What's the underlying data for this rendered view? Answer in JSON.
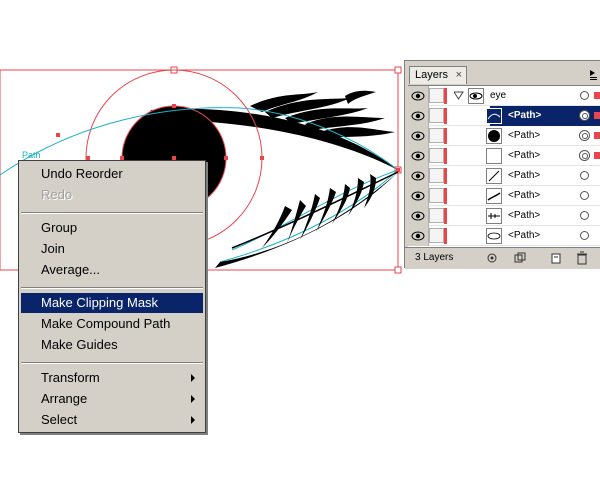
{
  "canvas": {
    "path_label": "Path",
    "colors": {
      "guide": "#e8454d",
      "path": "#1ab3c7",
      "art": "#000000"
    }
  },
  "context_menu": {
    "items": [
      {
        "label": "Undo Reorder",
        "enabled": true
      },
      {
        "label": "Redo",
        "enabled": false
      },
      {
        "label": "Group",
        "enabled": true
      },
      {
        "label": "Join",
        "enabled": true
      },
      {
        "label": "Average...",
        "enabled": true
      },
      {
        "label": "Make Clipping Mask",
        "enabled": true,
        "highlighted": true
      },
      {
        "label": "Make Compound Path",
        "enabled": true
      },
      {
        "label": "Make Guides",
        "enabled": true
      },
      {
        "label": "Transform",
        "enabled": true,
        "submenu": true
      },
      {
        "label": "Arrange",
        "enabled": true,
        "submenu": true
      },
      {
        "label": "Select",
        "enabled": true,
        "submenu": true
      }
    ],
    "highlight_color": "#0a246a"
  },
  "layers_panel": {
    "tab_label": "Layers",
    "close_glyph": "×",
    "layer_name": "eye",
    "rows": [
      {
        "label": "<Path>",
        "selected": true,
        "thumb": "white-line"
      },
      {
        "label": "<Path>",
        "selected": false,
        "thumb": "black-circle"
      },
      {
        "label": "<Path>",
        "selected": false,
        "thumb": "blank"
      },
      {
        "label": "<Path>",
        "selected": false,
        "thumb": "diagonal-line"
      },
      {
        "label": "<Path>",
        "selected": false,
        "thumb": "lashes-top"
      },
      {
        "label": "<Path>",
        "selected": false,
        "thumb": "lashes-bottom"
      },
      {
        "label": "<Path>",
        "selected": false,
        "thumb": "eye-outline"
      }
    ],
    "footer": {
      "layer_count": "3 Layers"
    },
    "accent_color": "#e8454d"
  }
}
